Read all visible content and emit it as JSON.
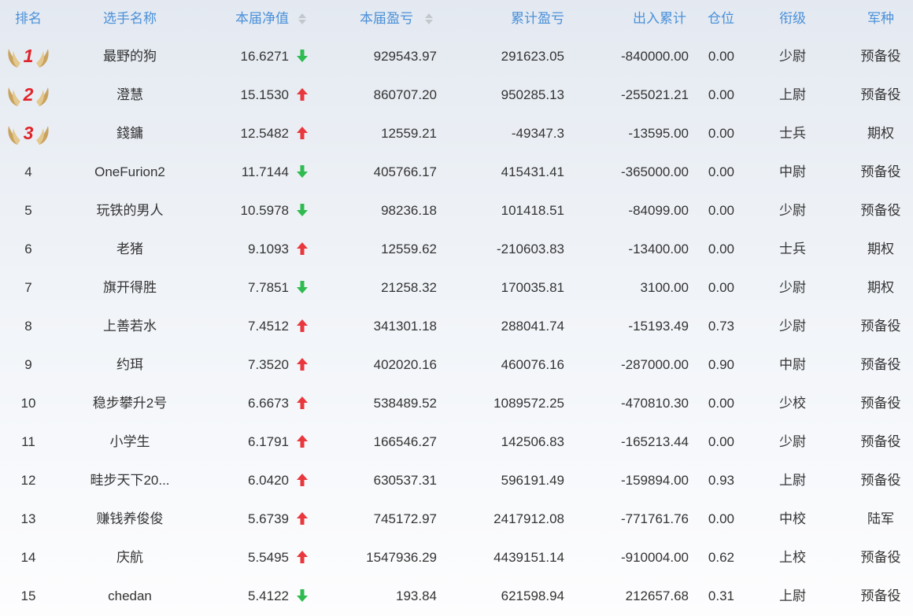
{
  "headers": {
    "rank": "排名",
    "name": "选手名称",
    "nav": "本届净值",
    "pnl": "本届盈亏",
    "cumulative": "累计盈亏",
    "flow": "出入累计",
    "position": "仓位",
    "grade": "衔级",
    "branch": "军种"
  },
  "colors": {
    "header_text": "#4a90d9",
    "up_arrow": "#e8383d",
    "down_arrow": "#2fbb4f",
    "medal_number": "#e0242a",
    "medal_wing": "#c9a25e"
  },
  "rows": [
    {
      "rank": "1",
      "medal": "gold-wings-medal",
      "name": "最野的狗",
      "nav": "16.6271",
      "trend": "down",
      "pnl": "929543.97",
      "cumulative": "291623.05",
      "flow": "-840000.00",
      "position": "0.00",
      "grade": "少尉",
      "branch": "预备役"
    },
    {
      "rank": "2",
      "medal": "gold-wings-medal",
      "name": "澄慧",
      "nav": "15.1530",
      "trend": "up",
      "pnl": "860707.20",
      "cumulative": "950285.13",
      "flow": "-255021.21",
      "position": "0.00",
      "grade": "上尉",
      "branch": "预备役"
    },
    {
      "rank": "3",
      "medal": "gold-wings-medal",
      "name": "錢鏞",
      "nav": "12.5482",
      "trend": "up",
      "pnl": "12559.21",
      "cumulative": "-49347.3",
      "flow": "-13595.00",
      "position": "0.00",
      "grade": "士兵",
      "branch": "期权"
    },
    {
      "rank": "4",
      "name": "OneFurion2",
      "nav": "11.7144",
      "trend": "down",
      "pnl": "405766.17",
      "cumulative": "415431.41",
      "flow": "-365000.00",
      "position": "0.00",
      "grade": "中尉",
      "branch": "预备役"
    },
    {
      "rank": "5",
      "name": "玩铁的男人",
      "nav": "10.5978",
      "trend": "down",
      "pnl": "98236.18",
      "cumulative": "101418.51",
      "flow": "-84099.00",
      "position": "0.00",
      "grade": "少尉",
      "branch": "预备役"
    },
    {
      "rank": "6",
      "name": "老猪",
      "nav": "9.1093",
      "trend": "up",
      "pnl": "12559.62",
      "cumulative": "-210603.83",
      "flow": "-13400.00",
      "position": "0.00",
      "grade": "士兵",
      "branch": "期权"
    },
    {
      "rank": "7",
      "name": "旗开得胜",
      "nav": "7.7851",
      "trend": "down",
      "pnl": "21258.32",
      "cumulative": "170035.81",
      "flow": "3100.00",
      "position": "0.00",
      "grade": "少尉",
      "branch": "期权"
    },
    {
      "rank": "8",
      "name": "上善若水",
      "nav": "7.4512",
      "trend": "up",
      "pnl": "341301.18",
      "cumulative": "288041.74",
      "flow": "-15193.49",
      "position": "0.73",
      "grade": "少尉",
      "branch": "预备役"
    },
    {
      "rank": "9",
      "name": "约珥",
      "nav": "7.3520",
      "trend": "up",
      "pnl": "402020.16",
      "cumulative": "460076.16",
      "flow": "-287000.00",
      "position": "0.90",
      "grade": "中尉",
      "branch": "预备役"
    },
    {
      "rank": "10",
      "name": "稳步攀升2号",
      "nav": "6.6673",
      "trend": "up",
      "pnl": "538489.52",
      "cumulative": "1089572.25",
      "flow": "-470810.30",
      "position": "0.00",
      "grade": "少校",
      "branch": "预备役"
    },
    {
      "rank": "11",
      "name": "小学生",
      "nav": "6.1791",
      "trend": "up",
      "pnl": "166546.27",
      "cumulative": "142506.83",
      "flow": "-165213.44",
      "position": "0.00",
      "grade": "少尉",
      "branch": "预备役"
    },
    {
      "rank": "12",
      "name": "畦步天下20...",
      "nav": "6.0420",
      "trend": "up",
      "pnl": "630537.31",
      "cumulative": "596191.49",
      "flow": "-159894.00",
      "position": "0.93",
      "grade": "上尉",
      "branch": "预备役"
    },
    {
      "rank": "13",
      "name": "赚钱养俊俊",
      "nav": "5.6739",
      "trend": "up",
      "pnl": "745172.97",
      "cumulative": "2417912.08",
      "flow": "-771761.76",
      "position": "0.00",
      "grade": "中校",
      "branch": "陆军"
    },
    {
      "rank": "14",
      "name": "庆航",
      "nav": "5.5495",
      "trend": "up",
      "pnl": "1547936.29",
      "cumulative": "4439151.14",
      "flow": "-910004.00",
      "position": "0.62",
      "grade": "上校",
      "branch": "预备役"
    },
    {
      "rank": "15",
      "name": "chedan",
      "nav": "5.4122",
      "trend": "down",
      "pnl": "193.84",
      "cumulative": "621598.94",
      "flow": "212657.68",
      "position": "0.31",
      "grade": "上尉",
      "branch": "预备役"
    }
  ]
}
